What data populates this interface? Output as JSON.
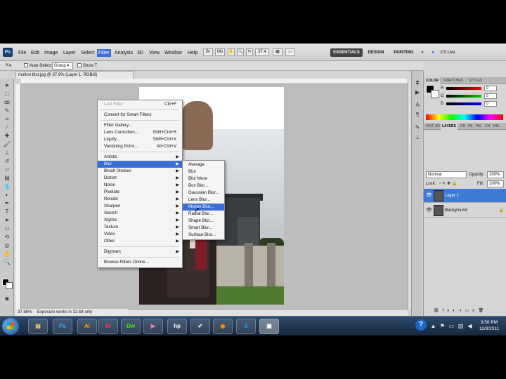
{
  "menubar": {
    "logo": "Ps",
    "items": [
      "File",
      "Edit",
      "Image",
      "Layer",
      "Select",
      "Filter",
      "Analysis",
      "3D",
      "View",
      "Window",
      "Help"
    ],
    "zoom": "37.4",
    "workspaces": [
      "ESSENTIALS",
      "DESIGN",
      "PAINTING",
      "»"
    ],
    "cslive": "CS Live"
  },
  "options": {
    "auto_select": "Auto-Select:",
    "group": "Group",
    "show_transform": "Show T"
  },
  "document": {
    "tab_title": "motion blur.jpg @ 37.9% (Layer 1, RGB/8)",
    "zoom_status": "37.86%",
    "status_text": "Exposure works in 32-bit only"
  },
  "filter_menu": {
    "items": [
      {
        "label": "Last Filter",
        "shortcut": "Ctrl+F",
        "disabled": true
      },
      {
        "label": "Convert for Smart Filters",
        "shortcut": ""
      },
      {
        "label": "Filter Gallery...",
        "shortcut": ""
      },
      {
        "label": "Lens Correction...",
        "shortcut": "Shift+Ctrl+R"
      },
      {
        "label": "Liquify...",
        "shortcut": "Shift+Ctrl+X"
      },
      {
        "label": "Vanishing Point...",
        "shortcut": "Alt+Ctrl+V"
      },
      {
        "label": "Artistic",
        "sub": true
      },
      {
        "label": "Blur",
        "sub": true,
        "highlight": true
      },
      {
        "label": "Brush Strokes",
        "sub": true
      },
      {
        "label": "Distort",
        "sub": true
      },
      {
        "label": "Noise",
        "sub": true
      },
      {
        "label": "Pixelate",
        "sub": true
      },
      {
        "label": "Render",
        "sub": true
      },
      {
        "label": "Sharpen",
        "sub": true
      },
      {
        "label": "Sketch",
        "sub": true
      },
      {
        "label": "Stylize",
        "sub": true
      },
      {
        "label": "Texture",
        "sub": true
      },
      {
        "label": "Video",
        "sub": true
      },
      {
        "label": "Other",
        "sub": true
      },
      {
        "label": "Digimarc",
        "sub": true
      },
      {
        "label": "Browse Filters Online...",
        "shortcut": ""
      }
    ]
  },
  "blur_menu": {
    "items": [
      "Average",
      "Blur",
      "Blur More",
      "Box Blur...",
      "Gaussian Blur...",
      "Lens Blur...",
      "Motion Blur...",
      "Radial Blur...",
      "Shape Blur...",
      "Smart Blur...",
      "Surface Blur..."
    ],
    "highlight_index": 6
  },
  "color_panel": {
    "tabs": [
      "COLOR",
      "SWATCHES",
      "STYLES"
    ],
    "channels": [
      {
        "label": "R",
        "value": "0",
        "color": "#d03030"
      },
      {
        "label": "G",
        "value": "0",
        "color": "#30a030"
      },
      {
        "label": "B",
        "value": "0",
        "color": "#3050d0"
      }
    ]
  },
  "layers_panel": {
    "tabs": [
      "HIST",
      "AD",
      "LAYERS",
      "CH",
      "PA",
      "PAI",
      "CH",
      "INS"
    ],
    "blend_mode": "Normal",
    "opacity_label": "Opacity:",
    "opacity_value": "100%",
    "lock_label": "Lock:",
    "fill_label": "Fill:",
    "fill_value": "100%",
    "layers": [
      {
        "name": "Layer 1",
        "selected": true,
        "locked": false
      },
      {
        "name": "Background",
        "selected": false,
        "locked": true
      }
    ]
  },
  "taskbar": {
    "apps": [
      "Ps",
      "Ai",
      "Id",
      "Dw"
    ],
    "time": "3:56 PM",
    "date": "11/9/2011",
    "help": "?"
  },
  "colors": {
    "accent": "#3b6fd6",
    "selected_layer": "#3d7dd9",
    "taskbar": "#1f3552"
  }
}
